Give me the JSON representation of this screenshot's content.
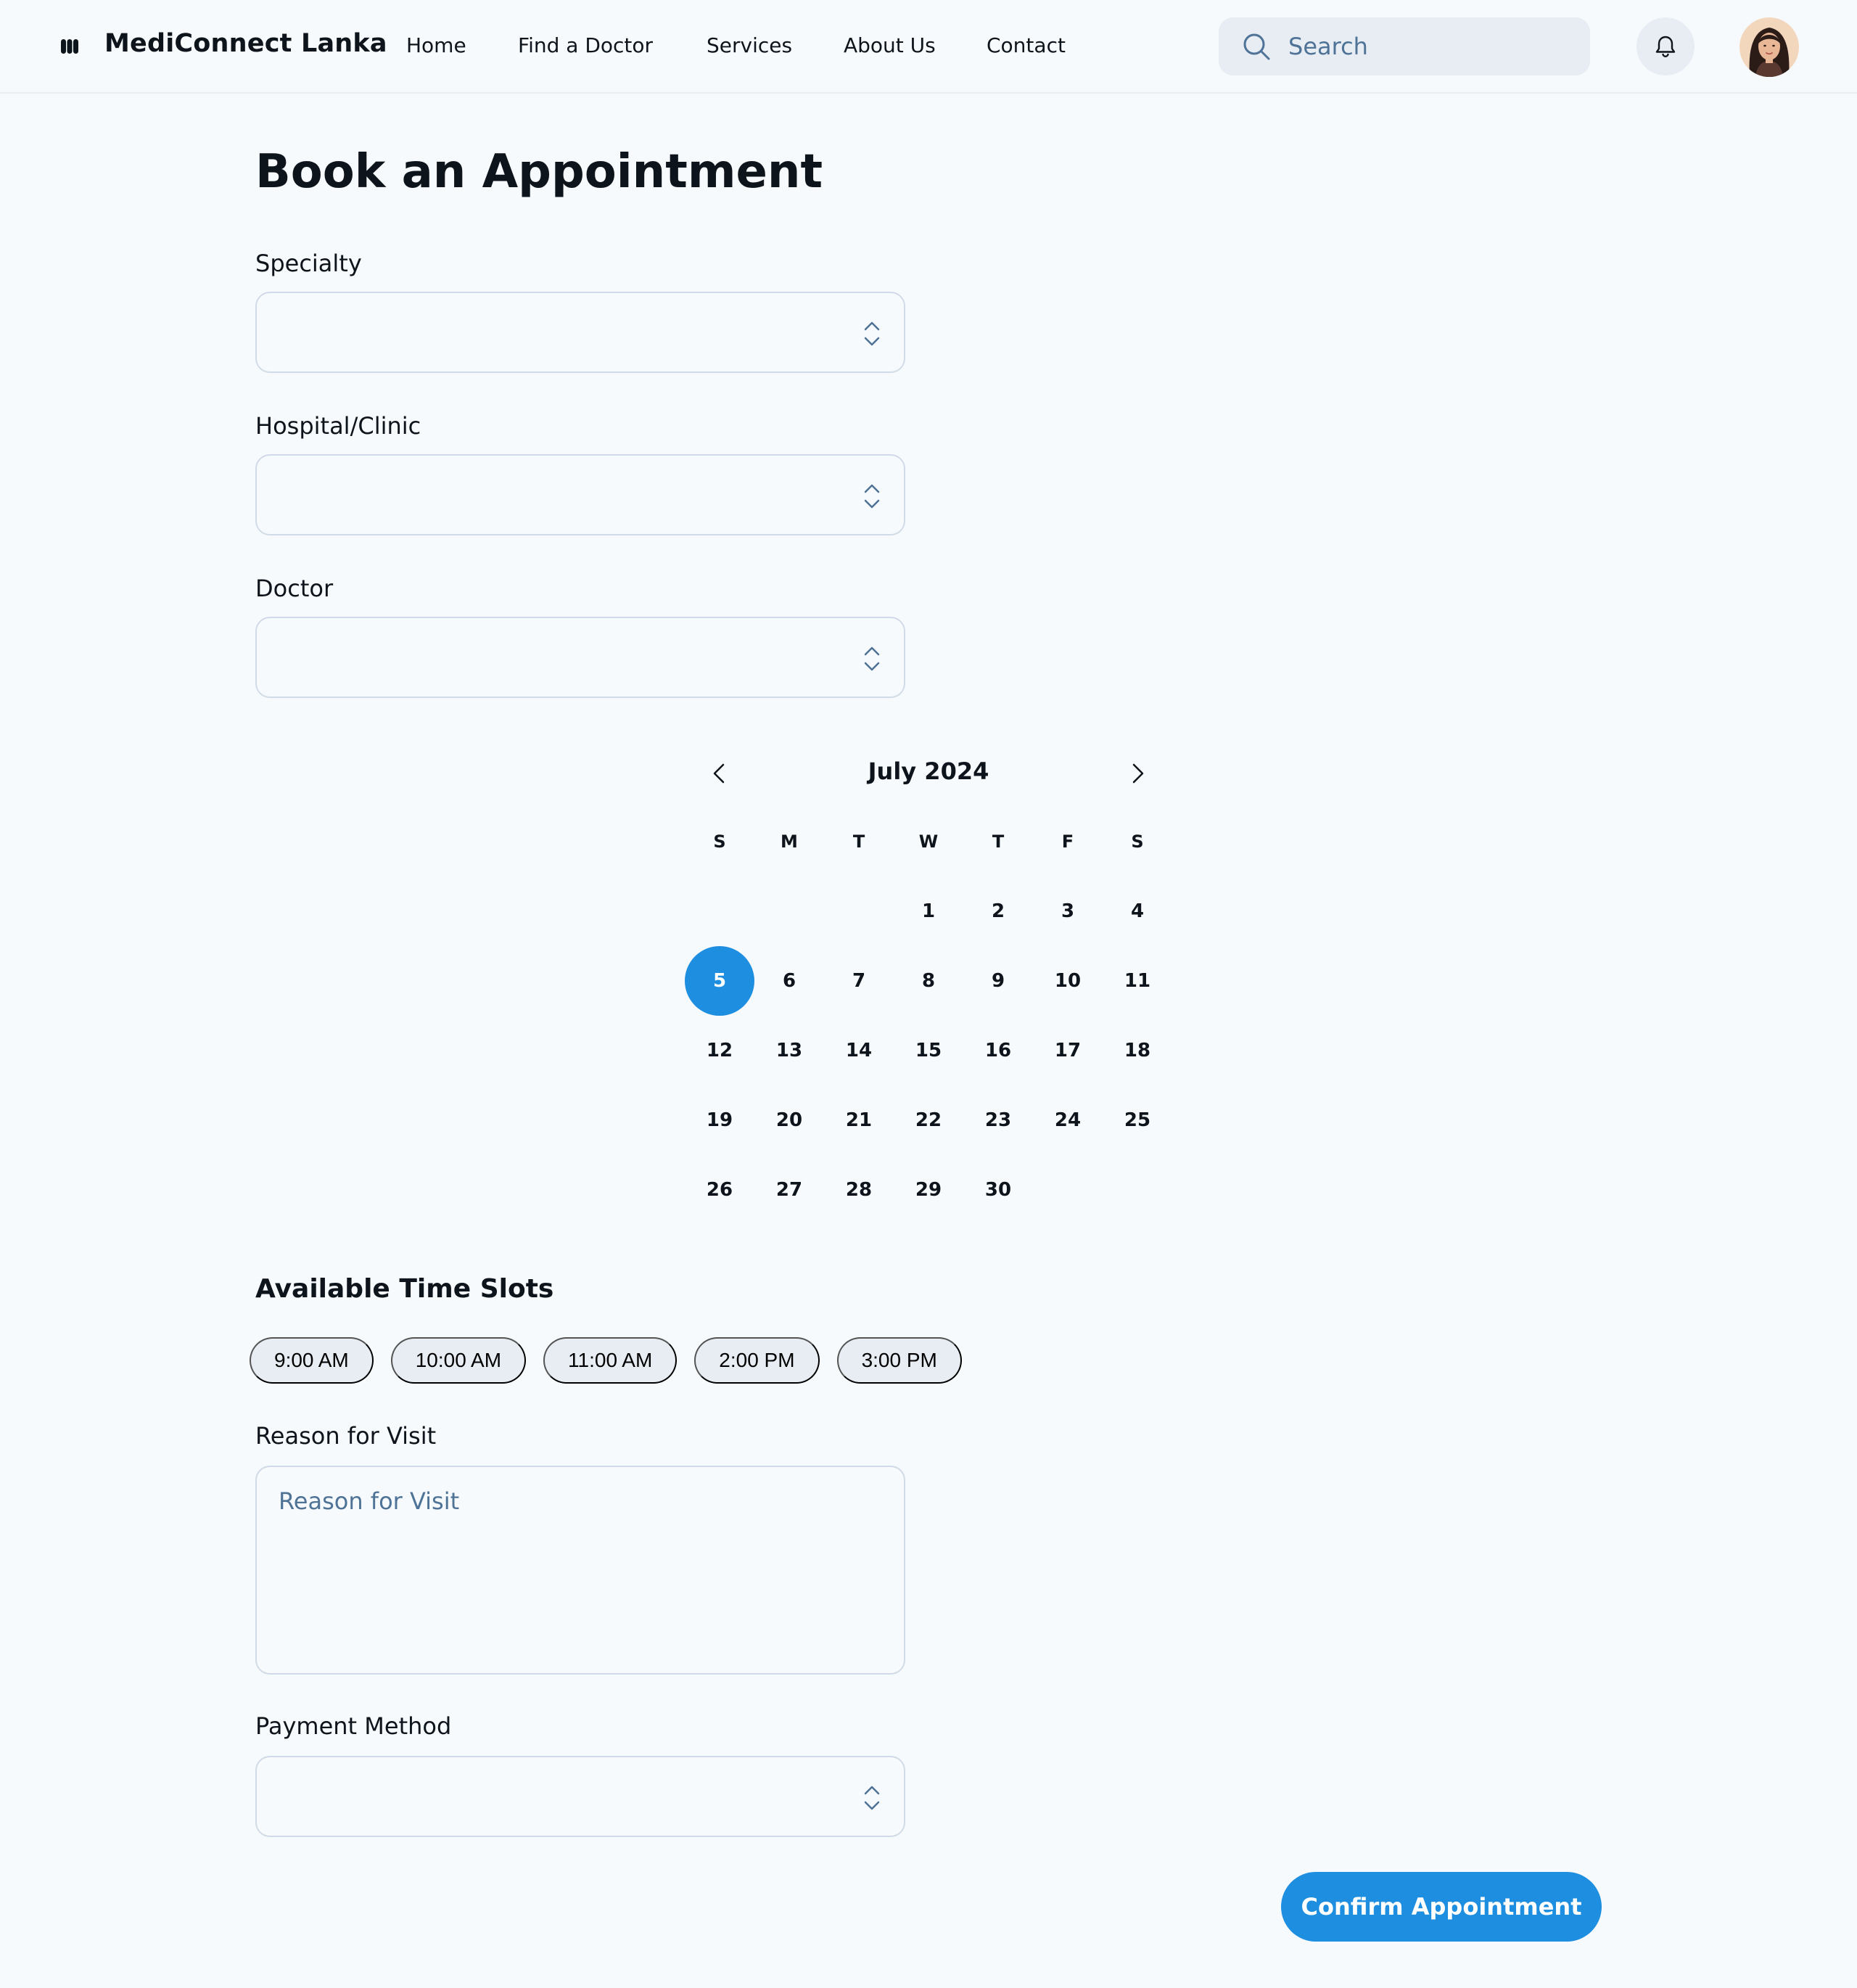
{
  "header": {
    "brand": "MediConnect Lanka",
    "logo_icon": "logo-icon",
    "nav": [
      {
        "label": "Home"
      },
      {
        "label": "Find a Doctor"
      },
      {
        "label": "Services"
      },
      {
        "label": "About Us"
      },
      {
        "label": "Contact"
      }
    ],
    "search": {
      "placeholder": "Search",
      "value": "",
      "icon": "search-icon"
    },
    "bell_icon": "bell-icon",
    "avatar": "user-avatar"
  },
  "page": {
    "title": "Book an Appointment"
  },
  "form": {
    "specialty": {
      "label": "Specialty",
      "value": ""
    },
    "hospital": {
      "label": "Hospital/Clinic",
      "value": ""
    },
    "doctor": {
      "label": "Doctor",
      "value": ""
    },
    "payment": {
      "label": "Payment Method",
      "value": ""
    },
    "reason": {
      "label": "Reason for Visit",
      "placeholder": "Reason for Visit",
      "value": ""
    }
  },
  "calendar": {
    "month_label": "July 2024",
    "weekdays": [
      "S",
      "M",
      "T",
      "W",
      "T",
      "F",
      "S"
    ],
    "leading_blanks": 3,
    "days": [
      "1",
      "2",
      "3",
      "4",
      "5",
      "6",
      "7",
      "8",
      "9",
      "10",
      "11",
      "12",
      "13",
      "14",
      "15",
      "16",
      "17",
      "18",
      "19",
      "20",
      "21",
      "22",
      "23",
      "24",
      "25",
      "26",
      "27",
      "28",
      "29",
      "30"
    ],
    "selected_day": "5",
    "prev_icon": "chevron-left-icon",
    "next_icon": "chevron-right-icon"
  },
  "time_slots": {
    "title": "Available Time Slots",
    "slots": [
      "9:00 AM",
      "10:00 AM",
      "11:00 AM",
      "2:00 PM",
      "3:00 PM"
    ]
  },
  "actions": {
    "confirm_label": "Confirm Appointment"
  },
  "colors": {
    "accent": "#1d8ee0",
    "background": "#f7fafc",
    "chip": "#e7edf3",
    "border": "#d0dbe7",
    "muted_text": "#4e7397",
    "text": "#0e141b"
  }
}
